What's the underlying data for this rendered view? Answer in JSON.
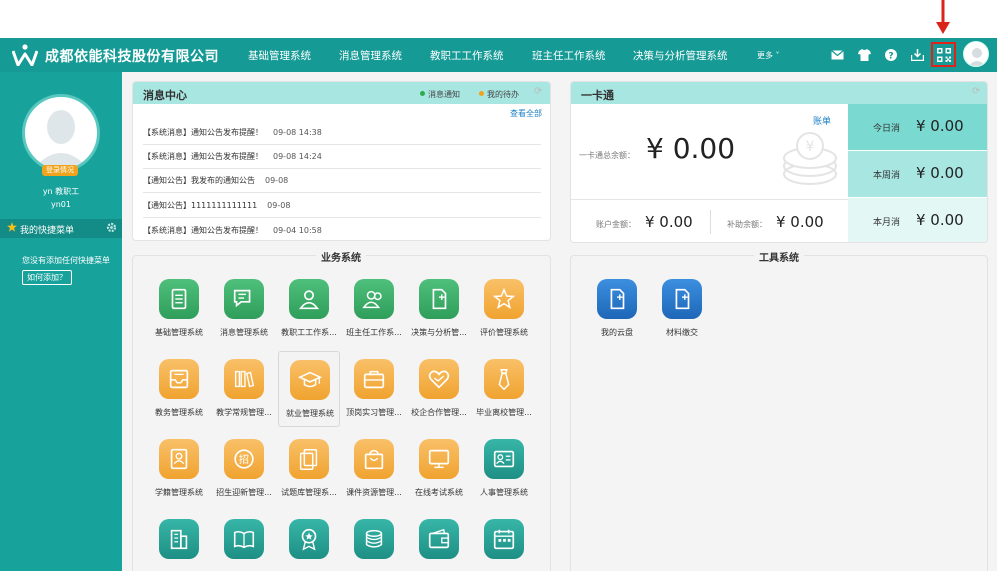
{
  "header": {
    "brand": "成都依能科技股份有限公司",
    "nav": [
      "基础管理系统",
      "消息管理系统",
      "教职工工作系统",
      "班主任工作系统",
      "决策与分析管理系统"
    ],
    "more": "更多 ˅"
  },
  "sidebar": {
    "login_badge": "登录情况",
    "user_line1": "yn   教职工",
    "user_line2": "yn01",
    "quick_menu_title": "我的快捷菜单",
    "empty_note": "您没有添加任何快捷菜单",
    "howto_button": "如何添加？"
  },
  "messages": {
    "title": "消息中心",
    "legend_notice": "消息通知",
    "legend_todo": "我的待办",
    "view_all": "查看全部",
    "colors": {
      "notice": "#2eaa4b",
      "todo": "#f0a31b"
    },
    "items": [
      {
        "text": "【系统消息】通知公告发布提醒！",
        "time": "09-08 14:38"
      },
      {
        "text": "【系统消息】通知公告发布提醒！",
        "time": "09-08 14:24"
      },
      {
        "text": "【通知公告】我发布的通知公告",
        "time": "09-08"
      },
      {
        "text": "【通知公告】1111111111111",
        "time": "09-08"
      },
      {
        "text": "【系统消息】通知公告发布提醒！",
        "time": "09-04 10:58"
      }
    ]
  },
  "card": {
    "title": "一卡通",
    "bill_link": "账单",
    "total_label": "一卡通总余额：",
    "total_value": "¥ 0.00",
    "account_label": "账户金额：",
    "account_value": "¥ 0.00",
    "subsidy_label": "补助余额：",
    "subsidy_value": "¥ 0.00",
    "today_label": "今日消",
    "today_value": "¥ 0.00",
    "week_label": "本周消",
    "week_value": "¥ 0.00",
    "month_label": "本月消",
    "month_value": "¥ 0.00"
  },
  "business": {
    "title": "业务系统",
    "apps": [
      {
        "label": "基础管理系统",
        "color": "green",
        "icon": "document-icon"
      },
      {
        "label": "消息管理系统",
        "color": "green",
        "icon": "chat-icon"
      },
      {
        "label": "教职工工作系...",
        "color": "green",
        "icon": "person-icon"
      },
      {
        "label": "班主任工作系...",
        "color": "green",
        "icon": "people-icon"
      },
      {
        "label": "决策与分析管...",
        "color": "green",
        "icon": "new-doc-icon"
      },
      {
        "label": "评价管理系统",
        "color": "orange",
        "icon": "star-icon"
      },
      {
        "label": "教务管理系统",
        "color": "orange",
        "icon": "inbox-icon"
      },
      {
        "label": "教学常规管理...",
        "color": "orange",
        "icon": "books-icon"
      },
      {
        "label": "就业管理系统",
        "color": "orange",
        "icon": "graduation-cap-icon"
      },
      {
        "label": "顶岗实习管理...",
        "color": "orange",
        "icon": "briefcase-icon"
      },
      {
        "label": "校企合作管理...",
        "color": "orange",
        "icon": "handshake-heart-icon"
      },
      {
        "label": "毕业离校管理...",
        "color": "orange",
        "icon": "tie-icon"
      },
      {
        "label": "学籍管理系统",
        "color": "orange",
        "icon": "student-book-icon"
      },
      {
        "label": "招生迎新管理...",
        "color": "orange",
        "icon": "recruit-icon"
      },
      {
        "label": "试题库管理系...",
        "color": "orange",
        "icon": "papers-icon"
      },
      {
        "label": "课件资源管理...",
        "color": "orange",
        "icon": "bag-icon"
      },
      {
        "label": "在线考试系统",
        "color": "orange",
        "icon": "monitor-icon"
      },
      {
        "label": "人事管理系统",
        "color": "teal",
        "icon": "id-card-icon"
      },
      {
        "label": "",
        "color": "teal",
        "icon": "building-icon"
      },
      {
        "label": "",
        "color": "teal",
        "icon": "open-book-icon"
      },
      {
        "label": "",
        "color": "teal",
        "icon": "medal-icon"
      },
      {
        "label": "",
        "color": "teal",
        "icon": "coins-icon"
      },
      {
        "label": "",
        "color": "teal",
        "icon": "wallet-icon"
      },
      {
        "label": "",
        "color": "teal",
        "icon": "calendar-icon"
      }
    ]
  },
  "tools": {
    "title": "工具系统",
    "apps": [
      {
        "label": "我的云盘",
        "color": "blue",
        "icon": "cloud-doc-icon"
      },
      {
        "label": "材料缴交",
        "color": "blue",
        "icon": "submit-doc-icon"
      }
    ]
  }
}
